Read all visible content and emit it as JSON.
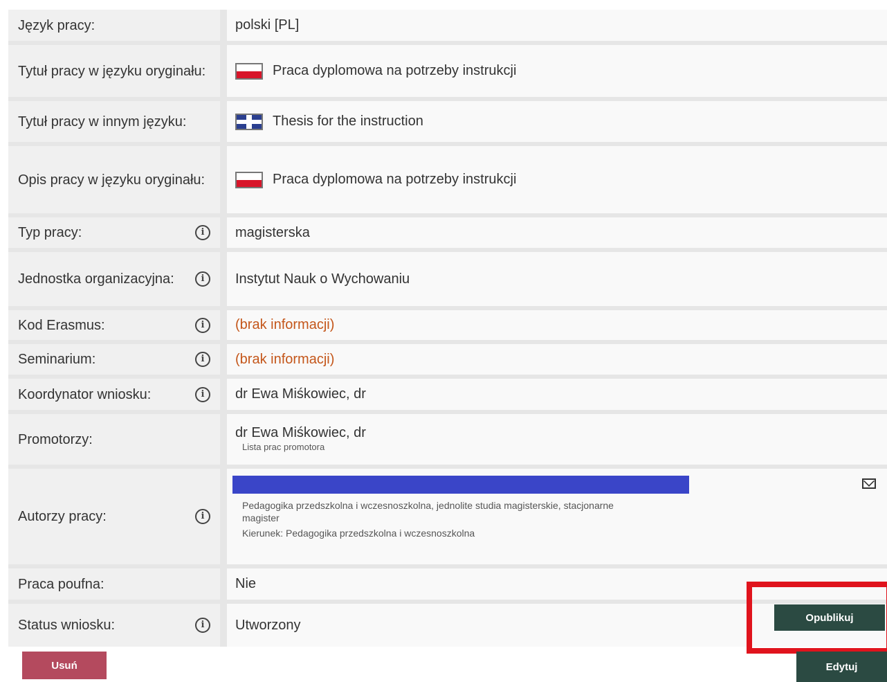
{
  "rows": {
    "language": {
      "label": "Język pracy:",
      "value": "polski [PL]"
    },
    "title_original": {
      "label": "Tytuł pracy w języku oryginału:",
      "value": "Praca dyplomowa na potrzeby instrukcji",
      "flag": "pl-flag-icon"
    },
    "title_other": {
      "label": "Tytuł pracy w innym języku:",
      "value": "Thesis for the instruction",
      "flag": "gb-flag-icon"
    },
    "description_original": {
      "label": "Opis pracy w języku oryginału:",
      "value": "Praca dyplomowa na potrzeby instrukcji",
      "flag": "pl-flag-icon"
    },
    "thesis_type": {
      "label": "Typ pracy:",
      "value": "magisterska"
    },
    "unit": {
      "label": "Jednostka organizacyjna:",
      "value": "Instytut Nauk o Wychowaniu"
    },
    "erasmus_code": {
      "label": "Kod Erasmus:",
      "value": "(brak informacji)"
    },
    "seminar": {
      "label": "Seminarium:",
      "value": "(brak informacji)"
    },
    "coordinator": {
      "label": "Koordynator wniosku:",
      "value": "dr Ewa Miśkowiec, dr"
    },
    "supervisors": {
      "label": "Promotorzy:",
      "value": "dr Ewa Miśkowiec, dr",
      "link": "Lista prac promotora"
    },
    "authors": {
      "label": "Autorzy pracy:",
      "program": "Pedagogika przedszkolna i wczesnoszkolna, jednolite studia magisterskie, stacjonarne",
      "degree": "magister",
      "field": "Kierunek: Pedagogika przedszkolna i wczesnoszkolna"
    },
    "confidential": {
      "label": "Praca poufna:",
      "value": "Nie"
    },
    "status": {
      "label": "Status wniosku:",
      "value": "Utworzony"
    }
  },
  "buttons": {
    "publish": "Opublikuj",
    "delete": "Usuń",
    "edit": "Edytuj"
  },
  "icons": {
    "info": "info-icon",
    "mail": "mail-icon"
  },
  "colors": {
    "author_redaction": "#3a45c8",
    "primary_button": "#2b4a42",
    "delete_button": "#b44a5e",
    "highlight": "#e0141d",
    "missing_info": "#c4561a"
  }
}
